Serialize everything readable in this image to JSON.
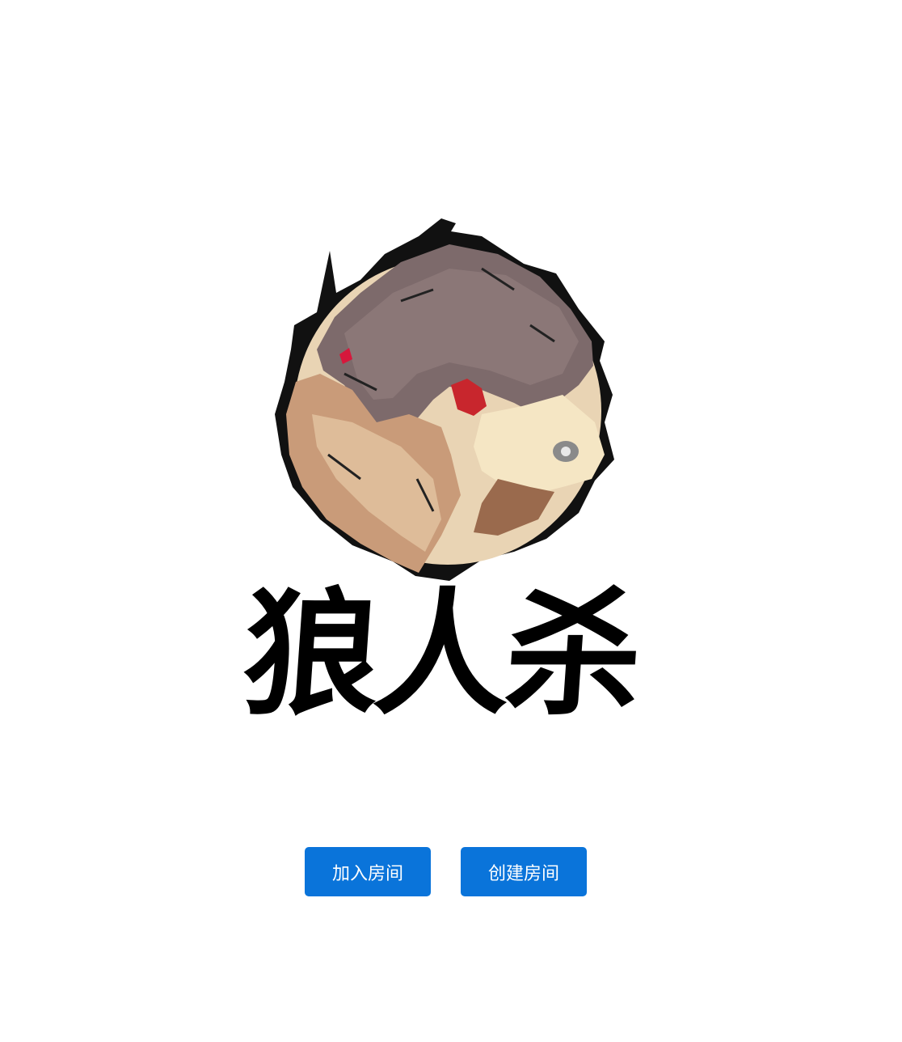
{
  "logo": {
    "icon": "werewolf-emblem-icon",
    "title": "狼人杀"
  },
  "actions": {
    "join_room_label": "加入房间",
    "create_room_label": "创建房间"
  },
  "colors": {
    "button_bg": "#0a74da",
    "background": "#ffffff"
  }
}
